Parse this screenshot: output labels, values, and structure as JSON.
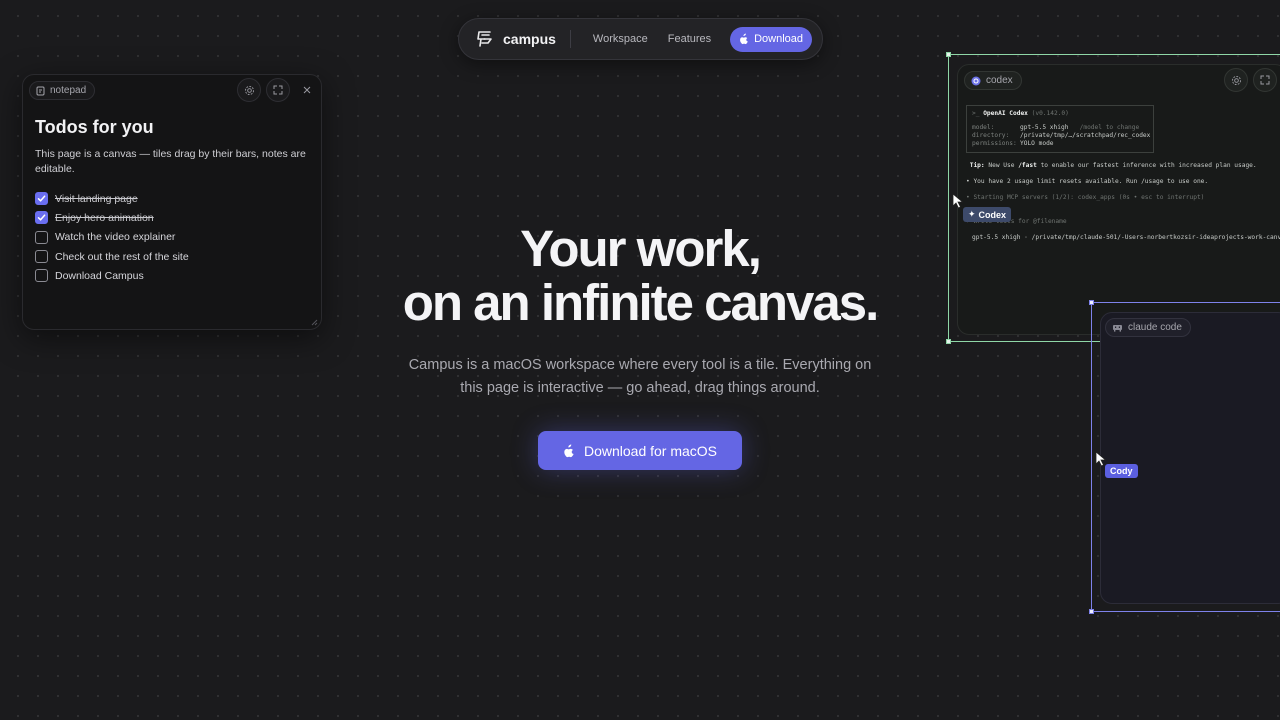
{
  "nav": {
    "brand": "campus",
    "links": [
      "Workspace",
      "Features"
    ],
    "download_label": "Download"
  },
  "notepad": {
    "chip_label": "notepad",
    "title": "Todos for you",
    "description": "This page is a canvas — tiles drag by their bars, notes are editable.",
    "todos": [
      {
        "label": "Visit landing page",
        "done": true
      },
      {
        "label": "Enjoy hero animation",
        "done": true
      },
      {
        "label": "Watch the video explainer",
        "done": false
      },
      {
        "label": "Check out the rest of the site",
        "done": false
      },
      {
        "label": "Download Campus",
        "done": false
      }
    ],
    "icons": [
      "notepad-icon",
      "settings-icon",
      "expand-icon",
      "close-icon"
    ]
  },
  "hero": {
    "title_line1": "Your work,",
    "title_line2": "on an infinite canvas.",
    "subtitle": "Campus is a macOS workspace where every tool is a tile. Everything on this page is interactive — go ahead, drag things around.",
    "cta_label": "Download for macOS"
  },
  "codex": {
    "chip_label": "codex",
    "header_prompt": ">_",
    "header_name": "OpenAI Codex",
    "header_version": "(v0.142.0)",
    "rows": [
      {
        "key": "model:",
        "value": "gpt-5.5 xhigh",
        "hint": "/model to change"
      },
      {
        "key": "directory:",
        "value": "/private/tmp/…/scratchpad/rec_codex",
        "hint": ""
      },
      {
        "key": "permissions:",
        "value": "YOLO mode",
        "hint": ""
      }
    ],
    "tip_label": "Tip:",
    "tip_text_pre": "New Use",
    "tip_cmd": "/fast",
    "tip_text_post": "to enable our fastest inference with increased plan usage.",
    "line_resets": "• You have 2 usage limit resets available. Run /usage to use one.",
    "line_mcp": "• Starting MCP servers (1/2): codex_apps (0s • esc to interrupt)",
    "line_prompt": "› Write tests for @filename",
    "line_status": "gpt-5.5 xhigh · /private/tmp/claude-501/-Users-norbertkozsir-ideaprojects-work-canva",
    "cursor_label": "Codex",
    "accent": "#8fd7a7"
  },
  "claude": {
    "chip_label": "claude code",
    "cursor_label": "Cody",
    "accent": "#6a6ef0"
  },
  "colors": {
    "background": "#1b1b1d",
    "primary": "#6466e4"
  }
}
